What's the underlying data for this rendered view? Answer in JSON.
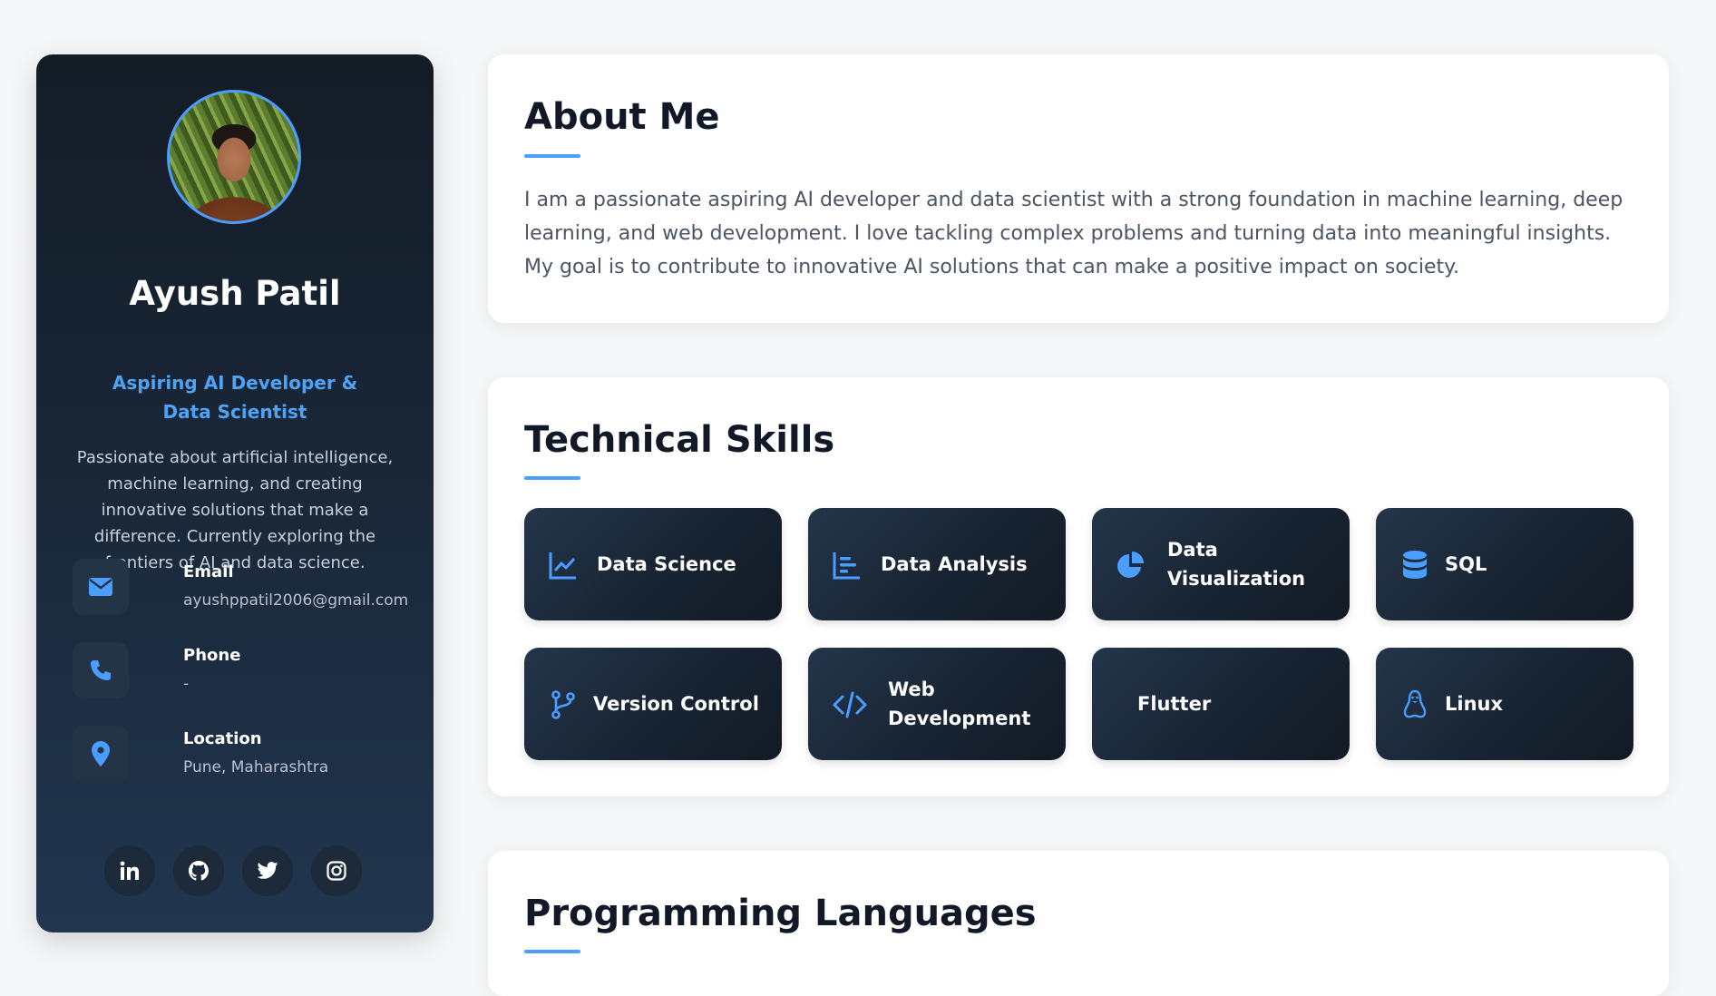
{
  "profile": {
    "name": "Ayush Patil",
    "role": "Aspiring AI Developer & Data Scientist",
    "bio": "Passionate about artificial intelligence, machine learning, and creating innovative solutions that make a difference. Currently exploring the frontiers of AI and data science."
  },
  "contacts": [
    {
      "label": "Email",
      "value": "ayushppatil2006@gmail.com",
      "icon": "envelope-icon"
    },
    {
      "label": "Phone",
      "value": "-",
      "icon": "phone-icon"
    },
    {
      "label": "Location",
      "value": "Pune, Maharashtra",
      "icon": "map-pin-icon"
    }
  ],
  "socials": [
    {
      "name": "LinkedIn",
      "icon": "linkedin-icon"
    },
    {
      "name": "GitHub",
      "icon": "github-icon"
    },
    {
      "name": "Twitter",
      "icon": "twitter-icon"
    },
    {
      "name": "Instagram",
      "icon": "instagram-icon"
    }
  ],
  "about": {
    "title": "About Me",
    "text": "I am a passionate aspiring AI developer and data scientist with a strong foundation in machine learning, deep learning, and web development. I love tackling complex problems and turning data into meaningful insights. My goal is to contribute to innovative AI solutions that can make a positive impact on society."
  },
  "skills": {
    "title": "Technical Skills",
    "items": [
      {
        "label": "Data Science",
        "icon": "line-chart-icon"
      },
      {
        "label": "Data Analysis",
        "icon": "bar-chart-icon"
      },
      {
        "label": "Data Visualization",
        "icon": "pie-chart-icon"
      },
      {
        "label": "SQL",
        "icon": "database-icon"
      },
      {
        "label": "Version Control",
        "icon": "git-branch-icon"
      },
      {
        "label": "Web Development",
        "icon": "code-icon"
      },
      {
        "label": "Flutter",
        "icon": ""
      },
      {
        "label": "Linux",
        "icon": "linux-icon"
      }
    ]
  },
  "languages": {
    "title": "Programming Languages"
  },
  "colors": {
    "accent": "#4a9eff",
    "sidebar_dark": "#141c26",
    "page_bg": "#f5f6f8"
  }
}
